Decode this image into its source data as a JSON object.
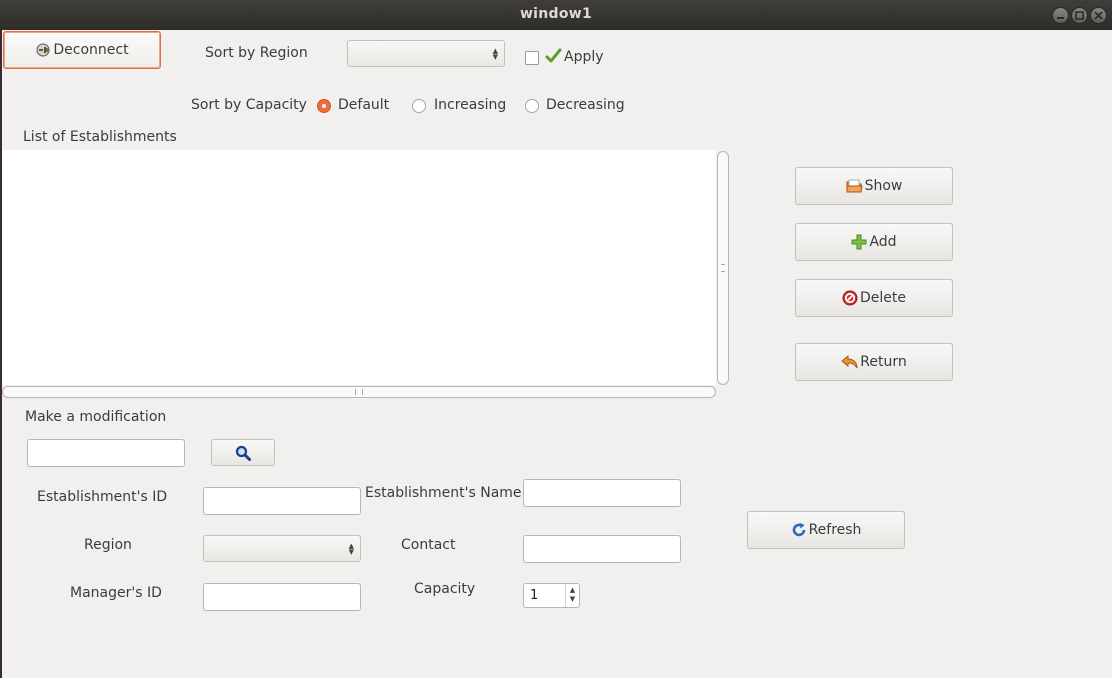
{
  "window": {
    "title": "window1"
  },
  "toolbar": {
    "deconnect_label": "Deconnect",
    "sort_region_label": "Sort by Region",
    "sort_region_value": "",
    "apply_label": "Apply",
    "apply_checked": false
  },
  "sort_capacity": {
    "label": "Sort by Capacity",
    "options": [
      {
        "label": "Default",
        "selected": true
      },
      {
        "label": "Increasing",
        "selected": false
      },
      {
        "label": "Decreasing",
        "selected": false
      }
    ]
  },
  "list": {
    "title": "List of Establishments",
    "items": []
  },
  "actions": {
    "show": "Show",
    "add": "Add",
    "delete": "Delete",
    "return": "Return",
    "refresh": "Refresh"
  },
  "modify": {
    "title": "Make a modification",
    "search_value": "",
    "fields": {
      "establishment_id_label": "Establishment's ID",
      "establishment_id_value": "",
      "establishment_name_label": "Establishment's Name",
      "establishment_name_value": "",
      "region_label": "Region",
      "region_value": "",
      "contact_label": "Contact",
      "contact_value": "",
      "manager_id_label": "Manager's ID",
      "manager_id_value": "",
      "capacity_label": "Capacity",
      "capacity_value": "1"
    }
  },
  "icons": {
    "deconnect": "plug-disconnect-icon",
    "apply": "checkmark-icon",
    "show": "folder-icon",
    "add": "plus-icon",
    "delete": "no-entry-icon",
    "return": "undo-arrow-icon",
    "refresh": "refresh-icon",
    "search": "magnifier-icon"
  },
  "colors": {
    "accent": "#e86d43",
    "radio_selected": "#f26b3c",
    "titlebar": "#3a3935",
    "window_bg": "#f1f0ef"
  }
}
